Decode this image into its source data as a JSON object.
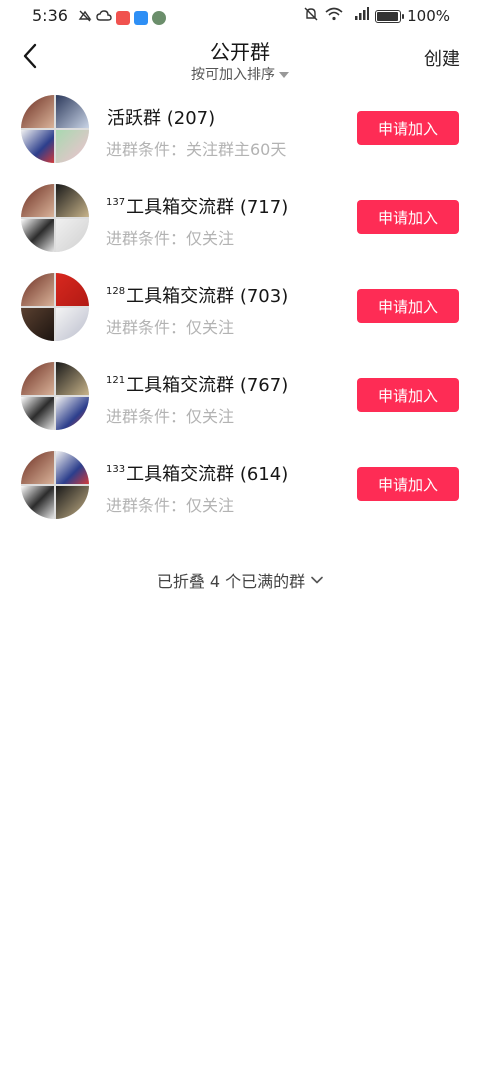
{
  "status_bar": {
    "time": "5:36",
    "battery_text": "100%",
    "battery_level": 1.0,
    "left_icons": [
      "mute-notif-icon",
      "cloud-icon",
      "red-app-icon",
      "blue-cloud-icon",
      "photo-app-icon"
    ],
    "right_icons": [
      "bell-off-icon",
      "wifi-icon",
      "4g-signal-icon",
      "battery-icon"
    ]
  },
  "header": {
    "title": "公开群",
    "sort_label": "按可加入排序",
    "create_label": "创建"
  },
  "colors": {
    "accent": "#fe2c55",
    "muted_text": "#b3b3b3"
  },
  "groups": [
    {
      "prefix": "",
      "name": "活跃群 (207)",
      "condition": "进群条件：关注群主60天",
      "join_label": "申请加入"
    },
    {
      "prefix": "137",
      "name": "工具箱交流群 (717)",
      "condition": "进群条件：仅关注",
      "join_label": "申请加入"
    },
    {
      "prefix": "128",
      "name": "工具箱交流群 (703)",
      "condition": "进群条件：仅关注",
      "join_label": "申请加入"
    },
    {
      "prefix": "121",
      "name": "工具箱交流群 (767)",
      "condition": "进群条件：仅关注",
      "join_label": "申请加入"
    },
    {
      "prefix": "133",
      "name": "工具箱交流群 (614)",
      "condition": "进群条件：仅关注",
      "join_label": "申请加入"
    }
  ],
  "collapsed_label": "已折叠 4 个已满的群"
}
